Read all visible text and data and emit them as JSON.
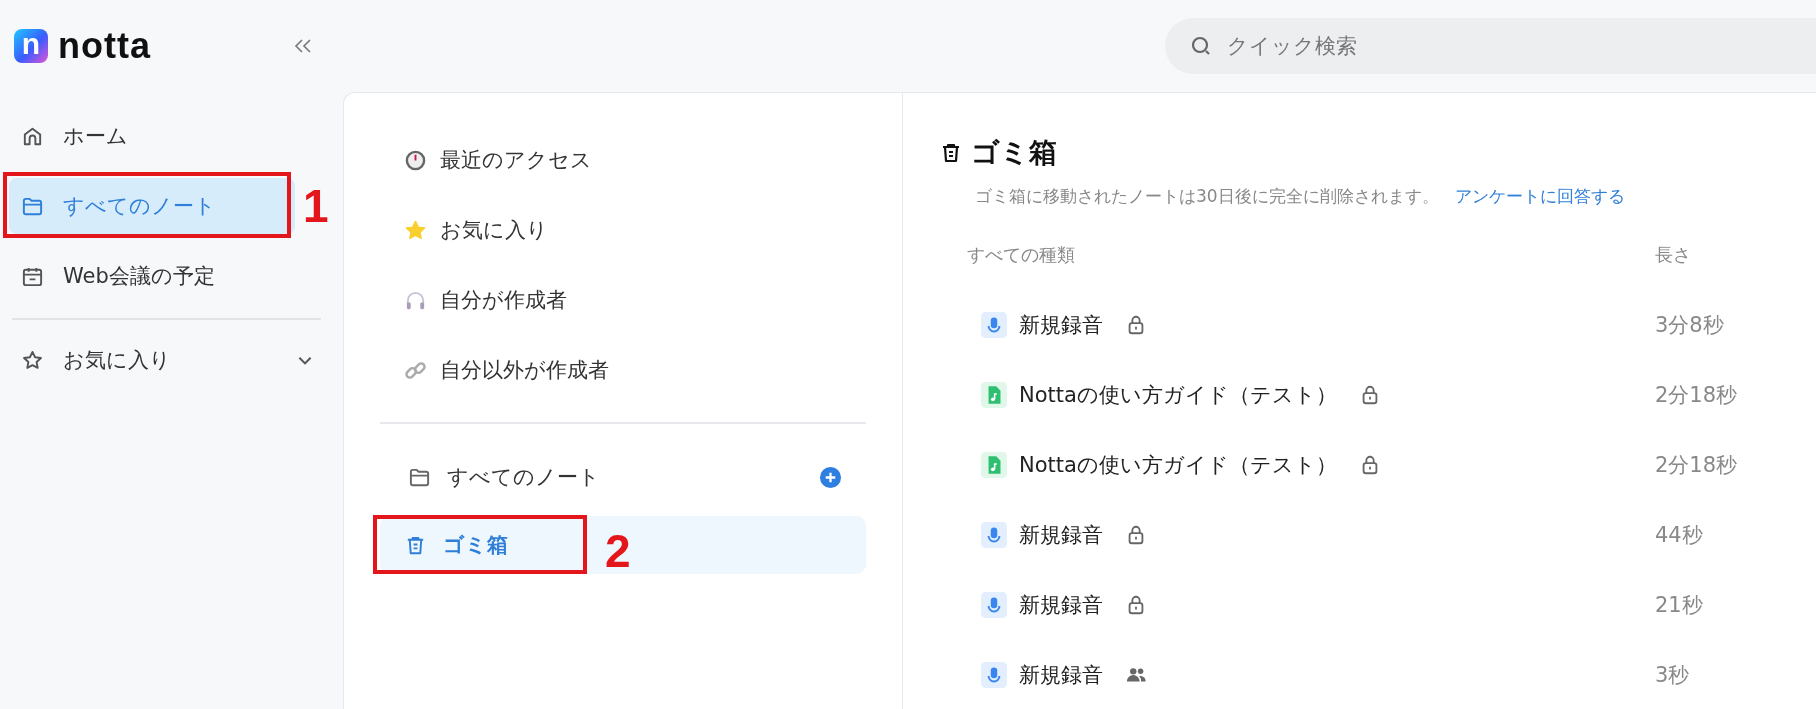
{
  "logo": {
    "mark": "n",
    "text": "notta"
  },
  "sidebar": {
    "items": [
      {
        "label": "ホーム",
        "kind": "home",
        "selected": false
      },
      {
        "label": "すべてのノート",
        "kind": "folder",
        "selected": true,
        "annotation": "1"
      },
      {
        "label": "Web会議の予定",
        "kind": "calendar",
        "selected": false
      }
    ],
    "favorites": {
      "label": "お気に入り",
      "expanded": false
    }
  },
  "search": {
    "placeholder": "クイック検索"
  },
  "folder_panel": {
    "quick_items": [
      {
        "label": "最近のアクセス",
        "kind": "clock"
      },
      {
        "label": "お気に入り",
        "kind": "star"
      },
      {
        "label": "自分が作成者",
        "kind": "headphones"
      },
      {
        "label": "自分以外が作成者",
        "kind": "link"
      }
    ],
    "folders": [
      {
        "label": "すべてのノート",
        "kind": "folder",
        "selected": false,
        "add_button": true
      },
      {
        "label": "ゴミ箱",
        "kind": "trash",
        "selected": true,
        "add_button": false,
        "annotation": "2"
      }
    ]
  },
  "content": {
    "title": "ゴミ箱",
    "notice": "ゴミ箱に移動されたノートは30日後に完全に削除されます。",
    "survey_link": "アンケートに回答する",
    "columns": [
      "すべての種類",
      "長さ"
    ],
    "rows": [
      {
        "kind": "audio",
        "title": "新規録音",
        "shared": false,
        "duration": "3分8秒"
      },
      {
        "kind": "media",
        "title": "Nottaの使い方ガイド（テスト）",
        "shared": false,
        "duration": "2分18秒"
      },
      {
        "kind": "media",
        "title": "Nottaの使い方ガイド（テスト）",
        "shared": false,
        "duration": "2分18秒"
      },
      {
        "kind": "audio",
        "title": "新規録音",
        "shared": false,
        "duration": "44秒"
      },
      {
        "kind": "audio",
        "title": "新規録音",
        "shared": false,
        "duration": "21秒"
      },
      {
        "kind": "audio",
        "title": "新規録音",
        "shared": true,
        "duration": "3秒"
      }
    ]
  }
}
